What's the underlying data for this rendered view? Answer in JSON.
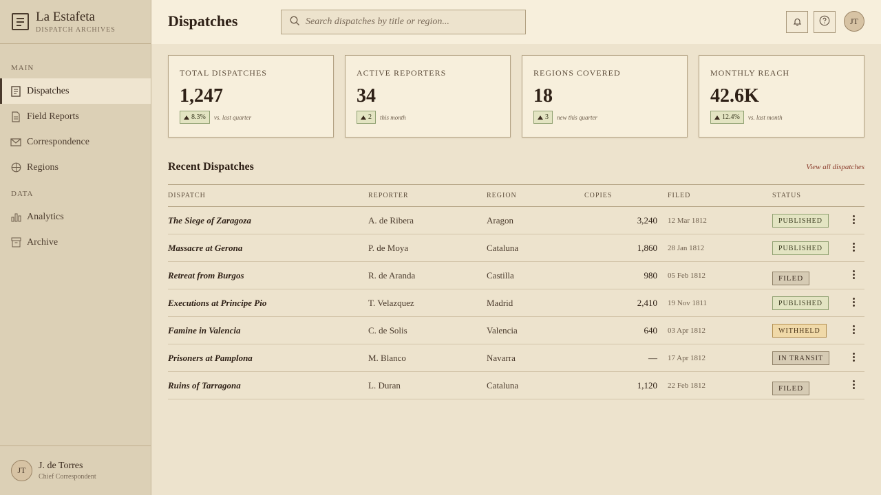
{
  "brand": {
    "name": "La Estafeta",
    "subtitle": "DISPATCH ARCHIVES"
  },
  "sidebar": {
    "sections": [
      {
        "label": "MAIN",
        "items": [
          {
            "label": "Dispatches",
            "icon": "document-icon",
            "active": true
          },
          {
            "label": "Field Reports",
            "icon": "page-icon"
          },
          {
            "label": "Correspondence",
            "icon": "envelope-icon"
          },
          {
            "label": "Regions",
            "icon": "globe-icon"
          }
        ]
      },
      {
        "label": "DATA",
        "items": [
          {
            "label": "Analytics",
            "icon": "bar-chart-icon"
          },
          {
            "label": "Archive",
            "icon": "archive-box-icon"
          }
        ]
      }
    ],
    "user": {
      "initials": "JT",
      "name": "J. de Torres",
      "role": "Chief Correspondent"
    }
  },
  "header": {
    "title": "Dispatches",
    "search_placeholder": "Search dispatches by title or region...",
    "avatar_initials": "JT"
  },
  "stats": [
    {
      "label": "TOTAL DISPATCHES",
      "value": "1,247",
      "delta": "8.3%",
      "note": "vs. last quarter"
    },
    {
      "label": "ACTIVE REPORTERS",
      "value": "34",
      "delta": "2",
      "note": "this month"
    },
    {
      "label": "REGIONS COVERED",
      "value": "18",
      "delta": "3",
      "note": "new this quarter"
    },
    {
      "label": "MONTHLY REACH",
      "value": "42.6K",
      "delta": "12.4%",
      "note": "vs. last month"
    }
  ],
  "recent": {
    "title": "Recent Dispatches",
    "view_all": "View all dispatches",
    "columns": [
      "DISPATCH",
      "REPORTER",
      "REGION",
      "COPIES",
      "FILED",
      "STATUS"
    ],
    "rows": [
      {
        "title": "The Siege of Zaragoza",
        "reporter": "A. de Ribera",
        "region": "Aragon",
        "copies": "3,240",
        "filed": "12 Mar 1812",
        "status": "PUBLISHED",
        "kind": "published"
      },
      {
        "title": "Massacre at Gerona",
        "reporter": "P. de Moya",
        "region": "Cataluna",
        "copies": "1,860",
        "filed": "28 Jan 1812",
        "status": "PUBLISHED",
        "kind": "published"
      },
      {
        "title": "Retreat from Burgos",
        "reporter": "R. de Aranda",
        "region": "Castilla",
        "copies": "980",
        "filed": "05 Feb 1812",
        "status": "FILED",
        "kind": "filed"
      },
      {
        "title": "Executions at Principe Pio",
        "reporter": "T. Velazquez",
        "region": "Madrid",
        "copies": "2,410",
        "filed": "19 Nov 1811",
        "status": "PUBLISHED",
        "kind": "published"
      },
      {
        "title": "Famine in Valencia",
        "reporter": "C. de Solis",
        "region": "Valencia",
        "copies": "640",
        "filed": "03 Apr 1812",
        "status": "WITHHELD",
        "kind": "withheld"
      },
      {
        "title": "Prisoners at Pamplona",
        "reporter": "M. Blanco",
        "region": "Navarra",
        "copies": "—",
        "filed": "17 Apr 1812",
        "status": "IN TRANSIT",
        "kind": "transit"
      },
      {
        "title": "Ruins of Tarragona",
        "reporter": "L. Duran",
        "region": "Cataluna",
        "copies": "1,120",
        "filed": "22 Feb 1812",
        "status": "FILED",
        "kind": "filed"
      }
    ]
  }
}
